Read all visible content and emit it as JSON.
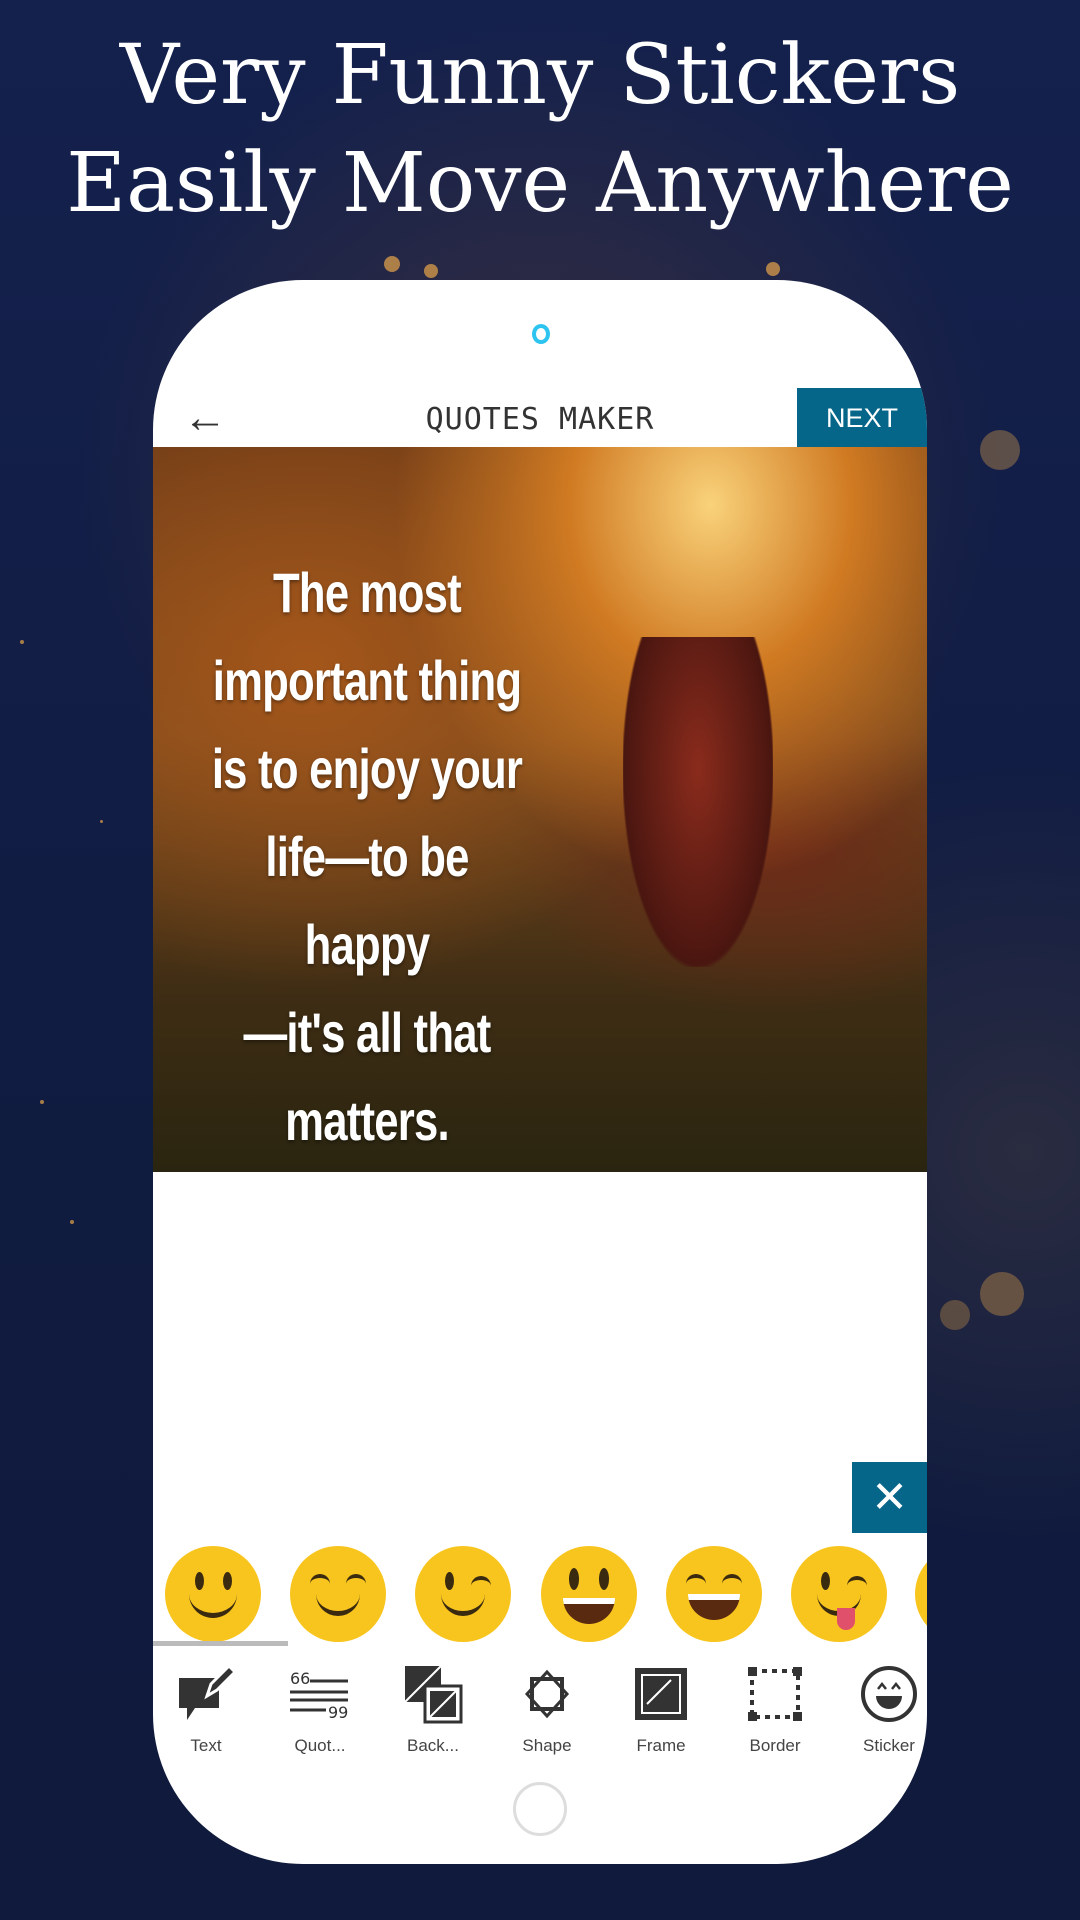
{
  "headline": {
    "line1": "Very Funny Stickers",
    "line2": "Easily Move Anywhere"
  },
  "app": {
    "title": "QUOTES MAKER",
    "back_icon": "arrow-left-icon",
    "next_label": "NEXT",
    "accent": "#066689"
  },
  "canvas": {
    "quote_lines": [
      "The most",
      "important thing",
      "is to enjoy your",
      "life—to be happy",
      "—it's all that",
      "matters."
    ],
    "sticker": "grinning-face",
    "delete_icon": "close-icon",
    "resize_icon": "resize-icon"
  },
  "sticker_panel": {
    "close_icon": "close-icon",
    "stickers": [
      "smiling",
      "smiling-eyes-closed",
      "winking",
      "grinning",
      "laughing",
      "tongue-out",
      "partial"
    ]
  },
  "toolbar": [
    {
      "label": "Text",
      "icon": "text-edit-icon"
    },
    {
      "label": "Quot...",
      "icon": "quote-icon"
    },
    {
      "label": "Back...",
      "icon": "background-icon"
    },
    {
      "label": "Shape",
      "icon": "shape-icon"
    },
    {
      "label": "Frame",
      "icon": "frame-icon"
    },
    {
      "label": "Border",
      "icon": "border-icon"
    },
    {
      "label": "Sticker",
      "icon": "sticker-icon"
    }
  ]
}
